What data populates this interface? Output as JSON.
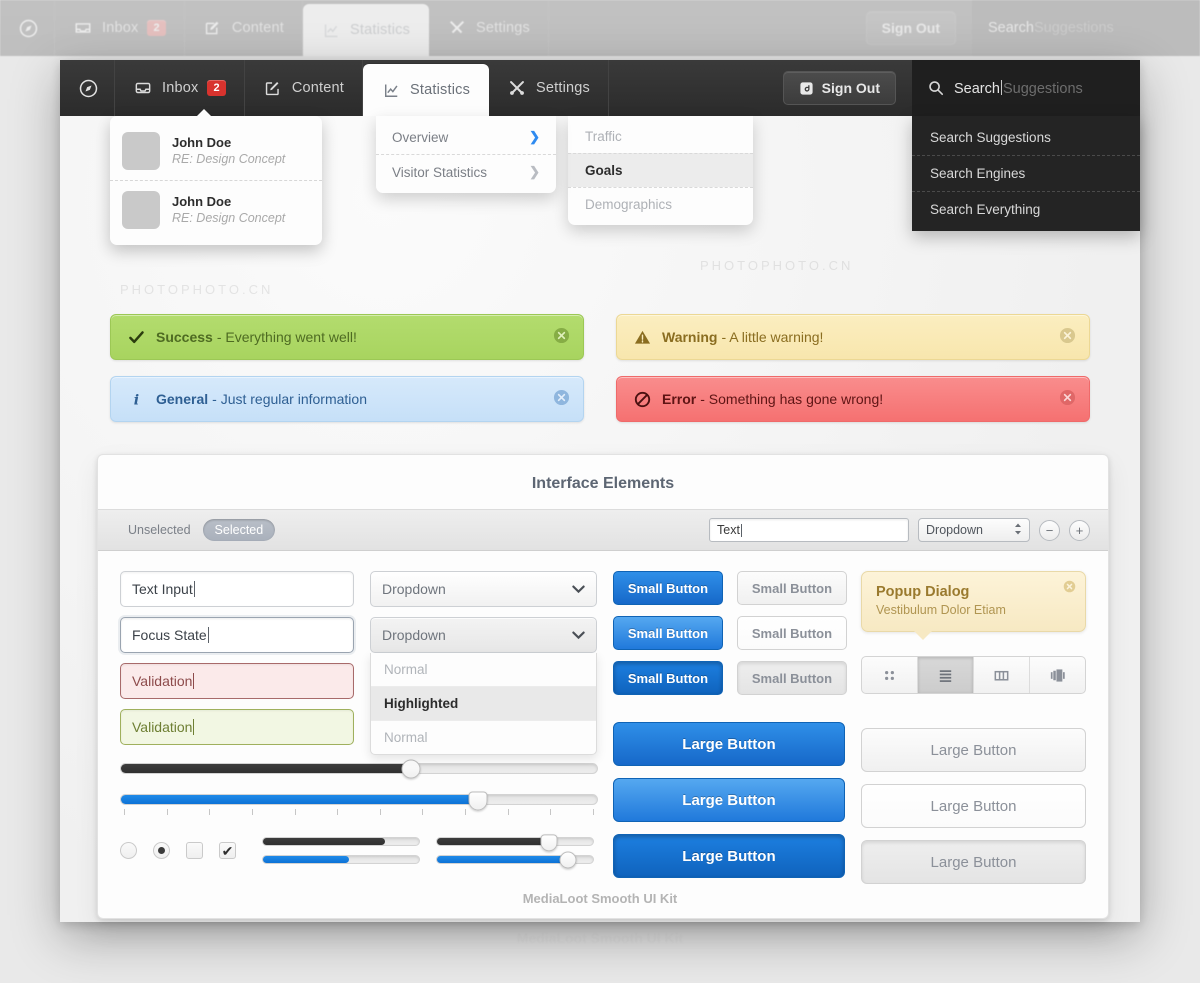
{
  "navbar": {
    "logo_icon": "compass-icon",
    "items": [
      {
        "id": "inbox",
        "label": "Inbox",
        "icon": "inbox-icon",
        "badge": "2",
        "active": false
      },
      {
        "id": "content",
        "label": "Content",
        "icon": "compose-icon",
        "badge": "",
        "active": false
      },
      {
        "id": "statistics",
        "label": "Statistics",
        "icon": "chart-icon",
        "badge": "",
        "active": true
      },
      {
        "id": "settings",
        "label": "Settings",
        "icon": "tools-icon",
        "badge": "",
        "active": false
      }
    ],
    "sign_out": {
      "label": "Sign Out",
      "icon": "signout-icon"
    },
    "search": {
      "icon": "search-icon",
      "value": "Search",
      "placeholder": "Suggestions"
    }
  },
  "inbox_dropdown": {
    "messages": [
      {
        "name": "John Doe",
        "subject": "RE: Design Concept"
      },
      {
        "name": "John Doe",
        "subject": "RE: Design Concept"
      }
    ]
  },
  "statistics_menu": {
    "items": [
      {
        "label": "Overview",
        "chevron": "chevron-right-icon",
        "active": true
      },
      {
        "label": "Visitor Statistics",
        "chevron": "chevron-right-icon",
        "active": false
      }
    ]
  },
  "statistics_submenu": {
    "items": [
      {
        "label": "Traffic",
        "selected": false
      },
      {
        "label": "Goals",
        "selected": true
      },
      {
        "label": "Demographics",
        "selected": false
      }
    ]
  },
  "search_dropdown": {
    "items": [
      {
        "label": "Search Suggestions"
      },
      {
        "label": "Search Engines"
      },
      {
        "label": "Search Everything"
      }
    ]
  },
  "alerts": [
    {
      "id": "success",
      "icon": "check-icon",
      "title": "Success",
      "text": "- Everything went well!",
      "close": "close-icon"
    },
    {
      "id": "warning",
      "icon": "warning-icon",
      "title": "Warning",
      "text": "- A little warning!",
      "close": "close-icon"
    },
    {
      "id": "general",
      "icon": "info-icon",
      "title": "General",
      "text": "- Just regular information",
      "close": "close-icon"
    },
    {
      "id": "error",
      "icon": "error-icon",
      "title": "Error",
      "text": "- Something has gone wrong!",
      "close": "close-icon"
    }
  ],
  "panel": {
    "title": "Interface Elements",
    "toolbar": {
      "segment": {
        "unselected": "Unselected",
        "selected": "Selected"
      },
      "text_input": {
        "value": "Text",
        "placeholder": "Text"
      },
      "dropdown": {
        "value": "Dropdown",
        "stepper_icon": "stepper-icon"
      },
      "minus": "−",
      "plus": "+"
    },
    "inputs": {
      "text_input": "Text Input",
      "focus_state": "Focus State",
      "validation_error": "Validation",
      "validation_ok": "Validation"
    },
    "dropdowns": {
      "closed_value": "Dropdown",
      "open_value": "Dropdown",
      "options": [
        {
          "label": "Normal",
          "highlighted": false
        },
        {
          "label": "Highlighted",
          "highlighted": true
        },
        {
          "label": "Normal",
          "highlighted": false
        }
      ]
    },
    "small_buttons": {
      "blue": [
        "Small Button",
        "Small Button",
        "Small Button"
      ],
      "grey": [
        "Small Button",
        "Small Button",
        "Small Button"
      ]
    },
    "large_buttons": {
      "blue": [
        "Large Button",
        "Large Button",
        "Large Button"
      ],
      "grey": [
        "Large Button",
        "Large Button",
        "Large Button"
      ]
    },
    "popup": {
      "title": "Popup Dialog",
      "subtitle": "Vestibulum Dolor Etiam",
      "close": "close-icon"
    },
    "view_switcher": [
      {
        "icon": "grid-view-icon",
        "active": false
      },
      {
        "icon": "list-view-icon",
        "active": true
      },
      {
        "icon": "column-view-icon",
        "active": false
      },
      {
        "icon": "coverflow-view-icon",
        "active": false
      }
    ],
    "sliders": {
      "dark_slider_pct": 61,
      "blue_slider_pct": 75,
      "tick_count": 12,
      "mini": [
        {
          "style": "dark",
          "pct": 78,
          "knob": "none"
        },
        {
          "style": "blue",
          "pct": 55,
          "knob": "none"
        },
        {
          "style": "dark",
          "pct": 72,
          "knob": "pin"
        },
        {
          "style": "blue",
          "pct": 84,
          "knob": "round"
        }
      ]
    },
    "toggles": {
      "radio_off": "radio-off-icon",
      "radio_on": "radio-on-icon",
      "checkbox_off": "checkbox-off-icon",
      "checkbox_on": "checkbox-on-icon",
      "check_glyph": "✔"
    }
  },
  "footer": {
    "text": "MediaLoot Smooth UI Kit"
  },
  "watermark": {
    "text": "PHOTOPHOTO.CN"
  },
  "colors": {
    "accent_blue": "#1f8ae8",
    "navbar_dark": "#2f2f2f",
    "badge_red": "#d8332e",
    "success": "#aed467",
    "warning": "#f8e6ad",
    "general": "#c6e0f8",
    "error": "#f57171"
  }
}
